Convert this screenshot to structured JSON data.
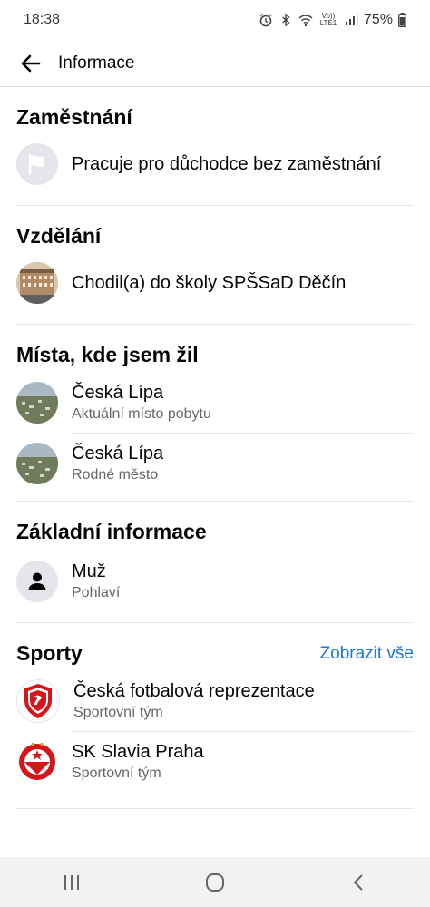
{
  "status": {
    "time": "18:38",
    "network": "Vo)) LTE1",
    "battery": "75%"
  },
  "header": {
    "title": "Informace"
  },
  "work": {
    "title": "Zaměstnání",
    "item": {
      "primary": "Pracuje pro důchodce bez zaměstnání",
      "icon": "flag-icon"
    }
  },
  "education": {
    "title": "Vzdělání",
    "item": {
      "primary": "Chodil(a) do školy SPŠSaD Děčín",
      "icon": "school-photo"
    }
  },
  "places": {
    "title": "Místa, kde jsem žil",
    "items": [
      {
        "primary": "Česká Lípa",
        "secondary": "Aktuální místo pobytu"
      },
      {
        "primary": "Česká Lípa",
        "secondary": "Rodné město"
      }
    ]
  },
  "basic": {
    "title": "Základní informace",
    "item": {
      "primary": "Muž",
      "secondary": "Pohlaví",
      "icon": "person-icon"
    }
  },
  "sports": {
    "title": "Sporty",
    "see_all": "Zobrazit vše",
    "items": [
      {
        "primary": "Česká fotbalová reprezentace",
        "secondary": "Sportovní tým"
      },
      {
        "primary": "SK Slavia Praha",
        "secondary": "Sportovní tým"
      }
    ]
  },
  "colors": {
    "link": "#1b74e4",
    "secondary_text": "#65676b",
    "icon_bg": "#e4e6eb"
  }
}
